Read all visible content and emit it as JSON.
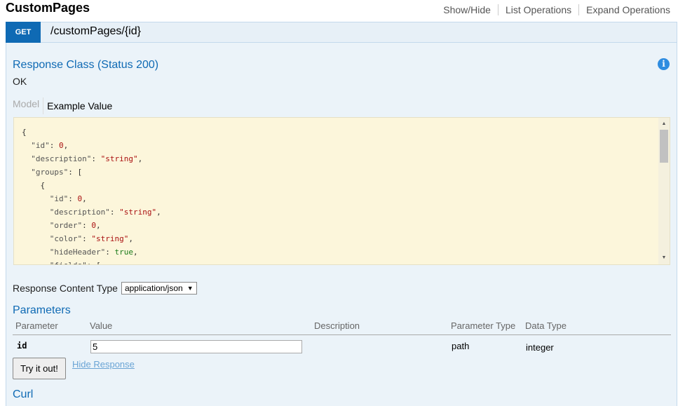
{
  "resource": {
    "title": "CustomPages",
    "links": [
      "Show/Hide",
      "List Operations",
      "Expand Operations"
    ]
  },
  "operation": {
    "method": "GET",
    "path": "/customPages/{id}"
  },
  "response_class": {
    "heading": "Response Class (Status 200)",
    "status_text": "OK",
    "tabs": {
      "model": "Model",
      "example": "Example Value"
    }
  },
  "example_value": {
    "lines": [
      "{",
      "  \"id\": 0,",
      "  \"description\": \"string\",",
      "  \"groups\": [",
      "    {",
      "      \"id\": 0,",
      "      \"description\": \"string\",",
      "      \"order\": 0,",
      "      \"color\": \"string\",",
      "      \"hideHeader\": true,",
      "      \"fields\": ["
    ]
  },
  "content_type": {
    "label": "Response Content Type",
    "selected": "application/json"
  },
  "parameters": {
    "heading": "Parameters",
    "columns": [
      "Parameter",
      "Value",
      "Description",
      "Parameter Type",
      "Data Type"
    ],
    "rows": [
      {
        "name": "id",
        "value": "5",
        "description": "",
        "param_type": "path",
        "data_type": "integer"
      }
    ]
  },
  "actions": {
    "try_label": "Try it out!",
    "hide_response_label": "Hide Response"
  },
  "curl": {
    "heading": "Curl"
  },
  "colors": {
    "method_badge": "#0f6ab4",
    "heading_blue": "#0f6ab4",
    "op_bg": "#ebf3f9",
    "snippet_bg": "#fcf6db"
  },
  "icons": {
    "info": "info-icon"
  }
}
